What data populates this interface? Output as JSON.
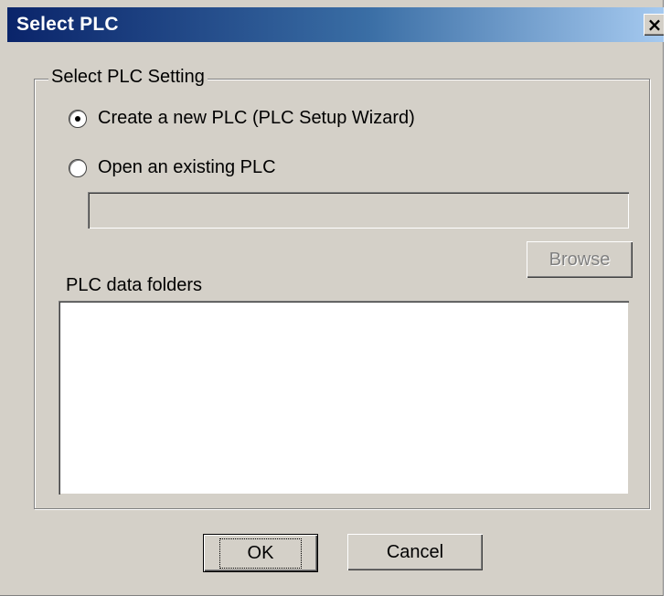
{
  "window": {
    "title": "Select PLC",
    "close_glyph": "✕"
  },
  "group": {
    "label": "Select PLC Setting"
  },
  "options": [
    {
      "label": "Create a new PLC (PLC Setup Wizard)",
      "selected": true
    },
    {
      "label": "Open an existing PLC",
      "selected": false
    }
  ],
  "path_field": {
    "value": "",
    "enabled": false
  },
  "browse": {
    "label": "Browse",
    "enabled": false
  },
  "folders": {
    "label": "PLC data folders",
    "items": []
  },
  "buttons": {
    "ok_label": "OK",
    "cancel_label": "Cancel"
  },
  "colors": {
    "face": "#d4d0c8",
    "title_start": "#0a246a",
    "title_end": "#a6caf0",
    "disabled_text": "#808080"
  }
}
